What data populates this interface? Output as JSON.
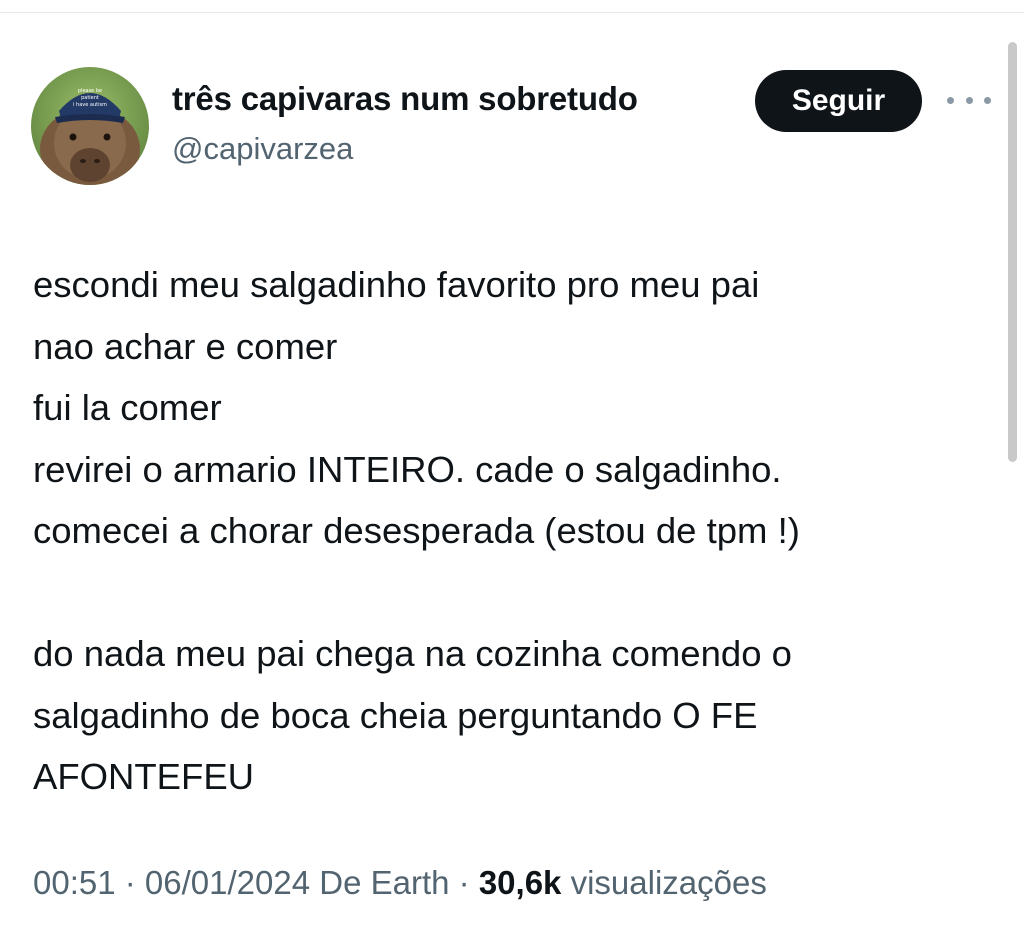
{
  "author": {
    "display_name": "três capivaras num sobretudo",
    "handle": "@capivarzea",
    "avatar_hat_text": "please be patient i have autism"
  },
  "actions": {
    "follow_label": "Seguir",
    "more_icon": "more-horizontal-icon"
  },
  "tweet": {
    "lines": [
      "escondi meu salgadinho favorito pro meu pai",
      "nao achar e comer",
      "fui la comer",
      "revirei o armario INTEIRO. cade o salgadinho.",
      "comecei a chorar desesperada (estou de tpm !)",
      "",
      "do nada meu pai chega na cozinha comendo o",
      "salgadinho de boca cheia perguntando O FE",
      "AFONTEFEU"
    ]
  },
  "meta": {
    "time": "00:51",
    "separator": " · ",
    "date": "06/01/2024",
    "source": "De Earth",
    "views_count": "30,6k",
    "views_label": "visualizações"
  },
  "colors": {
    "text": "#0f1419",
    "secondary": "#536471",
    "button_bg": "#0f1419",
    "button_text": "#ffffff"
  }
}
